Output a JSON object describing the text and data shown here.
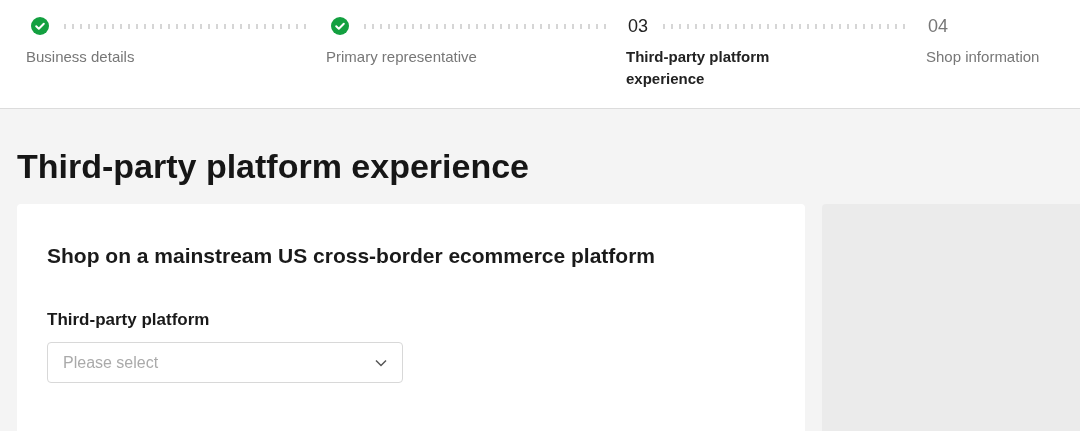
{
  "steps": [
    {
      "kind": "done",
      "label": "Business details"
    },
    {
      "kind": "done",
      "label": "Primary representative"
    },
    {
      "kind": "current",
      "number": "03",
      "label": "Third-party platform experience"
    },
    {
      "kind": "upcoming",
      "number": "04",
      "label": "Shop information"
    }
  ],
  "page_title": "Third-party platform experience",
  "card": {
    "title": "Shop on a mainstream US cross-border ecommerce platform",
    "field": {
      "label": "Third-party platform",
      "placeholder": "Please select"
    }
  }
}
